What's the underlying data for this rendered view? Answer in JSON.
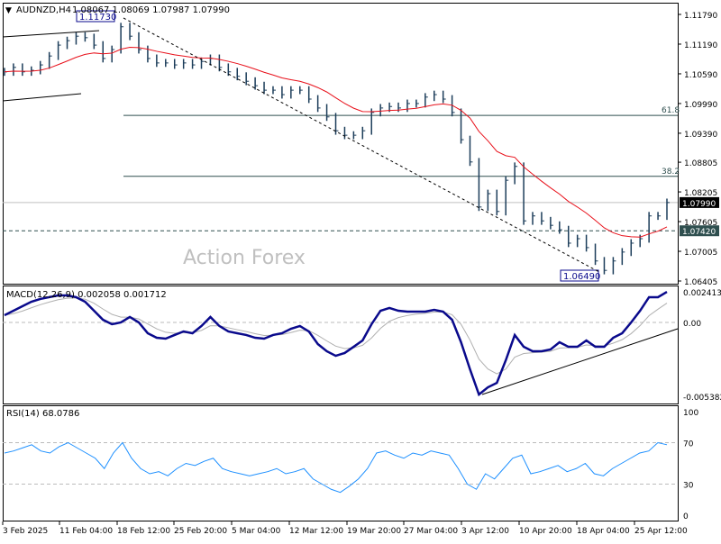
{
  "header": {
    "symbol": "AUDNZD,H4",
    "ohlc": "1.08067 1.08069 1.07987 1.07990"
  },
  "watermark": "Action Forex",
  "colors": {
    "bars": "#1c3d5a",
    "ma": "#e8101a",
    "macd": "#0a0a8c",
    "signal": "#b0b0b0",
    "rsi": "#1e90ff",
    "fib": "#2f4f4f"
  },
  "chart_data": [
    {
      "type": "line",
      "title": "AUDNZD,H4",
      "y_ticks": [
        "1.11790",
        "1.11190",
        "1.10590",
        "1.09990",
        "1.09390",
        "1.08805",
        "1.08205",
        "1.07605",
        "1.07005",
        "1.06405"
      ],
      "ylim": [
        1.0635,
        1.119
      ],
      "x_ticks": [
        "3 Feb 2025",
        "11 Feb 04:00",
        "18 Feb 12:00",
        "25 Feb 20:00",
        "5 Mar 04:00",
        "12 Mar 12:00",
        "19 Mar 20:00",
        "27 Mar 04:00",
        "3 Apr 12:00",
        "10 Apr 20:00",
        "18 Apr 04:00",
        "25 Apr 12:00"
      ],
      "close": [
        1.1063,
        1.1072,
        1.1063,
        1.1066,
        1.1077,
        1.1095,
        1.1117,
        1.1126,
        1.1135,
        1.1132,
        1.1117,
        1.109,
        1.1108,
        1.1154,
        1.1135,
        1.1108,
        1.109,
        1.1081,
        1.1081,
        1.1077,
        1.1081,
        1.1077,
        1.1084,
        1.109,
        1.1072,
        1.1063,
        1.1054,
        1.1044,
        1.1035,
        1.1026,
        1.1026,
        1.1017,
        1.1026,
        1.1026,
        1.1008,
        1.099,
        1.0972,
        1.0944,
        1.0935,
        1.0935,
        1.0944,
        1.0981,
        1.099,
        1.0993,
        1.099,
        1.0999,
        1.0999,
        1.1012,
        1.1017,
        1.1008,
        1.0981,
        1.0926,
        1.0881,
        1.079,
        1.0817,
        1.0781,
        1.0844,
        1.0872,
        1.0762,
        1.0772,
        1.0762,
        1.0753,
        1.0744,
        1.0717,
        1.0726,
        1.0708,
        1.0681,
        1.0662,
        1.0681,
        1.0699,
        1.0717,
        1.0726,
        1.0772,
        1.0772,
        1.0799
      ],
      "current_price": "1.07990",
      "support_level": {
        "value": 1.0742,
        "label": "1.07420"
      },
      "fib_levels": [
        {
          "label": "61.8",
          "value": 1.0975
        },
        {
          "label": "38.2",
          "value": 1.0852
        }
      ],
      "annotations": {
        "high": {
          "label": "1.11730",
          "value": 1.1173
        },
        "low": {
          "label": "1.06490",
          "value": 1.0649
        }
      }
    },
    {
      "type": "line",
      "title": "MACD(12,26,9) 0.002058 0.001712",
      "y_ticks": [
        "0.002413",
        "0.00",
        "-0.005382"
      ],
      "ylim": [
        -0.0058,
        0.0028
      ],
      "macd": [
        0.00057,
        0.00092,
        0.00128,
        0.00163,
        0.00185,
        0.00199,
        0.00213,
        0.00213,
        0.00199,
        0.00163,
        0.00092,
        0.00021,
        -0.00014,
        0,
        0.00043,
        0,
        -0.00085,
        -0.00121,
        -0.00128,
        -0.00099,
        -0.00071,
        -0.00085,
        -0.00028,
        0.00043,
        -0.00028,
        -0.00071,
        -0.00085,
        -0.00099,
        -0.00121,
        -0.00128,
        -0.00099,
        -0.00085,
        -0.0005,
        -0.00028,
        -0.00071,
        -0.0017,
        -0.00227,
        -0.00263,
        -0.00241,
        -0.00192,
        -0.00142,
        -0.00014,
        0.00092,
        0.00114,
        0.00092,
        0.00085,
        0.00085,
        0.00085,
        0.00099,
        0.00085,
        0.00021,
        -0.00156,
        -0.00369,
        -0.00568,
        -0.00511,
        -0.00476,
        -0.00298,
        -0.00099,
        -0.00192,
        -0.00227,
        -0.00227,
        -0.00213,
        -0.00156,
        -0.00192,
        -0.00192,
        -0.00142,
        -0.00192,
        -0.00192,
        -0.00121,
        -0.00085,
        0,
        0.00092,
        0.00199,
        0.00199,
        0.00241
      ]
    },
    {
      "type": "line",
      "title": "RSI(14) 68.0786",
      "y_ticks": [
        "100",
        "70",
        "30",
        "0"
      ],
      "ylim": [
        0,
        100
      ],
      "levels": [
        70,
        30
      ],
      "rsi": [
        60,
        62,
        65,
        68,
        62,
        60,
        66,
        70,
        65,
        60,
        55,
        45,
        60,
        70,
        55,
        45,
        40,
        42,
        38,
        45,
        50,
        48,
        52,
        55,
        45,
        42,
        40,
        38,
        40,
        42,
        45,
        40,
        42,
        45,
        35,
        30,
        25,
        22,
        28,
        35,
        45,
        60,
        62,
        58,
        55,
        60,
        58,
        62,
        60,
        58,
        45,
        30,
        25,
        40,
        35,
        45,
        55,
        58,
        40,
        42,
        45,
        48,
        42,
        45,
        50,
        40,
        38,
        45,
        50,
        55,
        60,
        62,
        70,
        68
      ]
    }
  ]
}
